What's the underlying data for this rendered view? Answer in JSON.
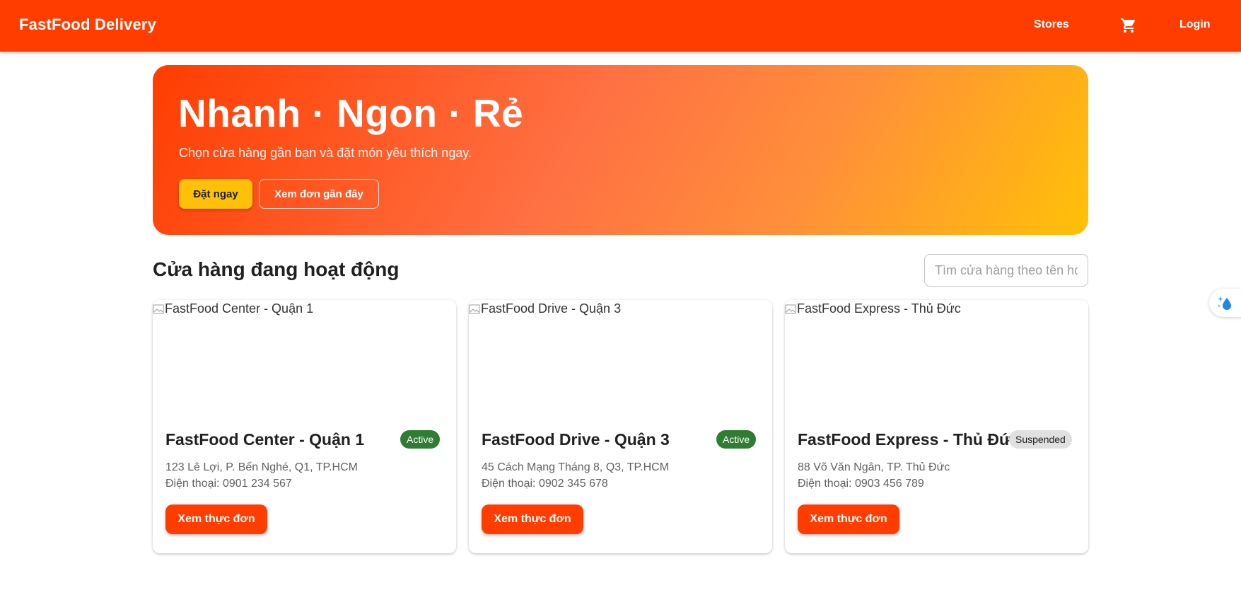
{
  "header": {
    "brand": "FastFood Delivery",
    "nav_stores": "Stores",
    "cart_icon": "shopping-cart-icon",
    "nav_login": "Login",
    "background_color": "#ff3d00"
  },
  "hero": {
    "title": "Nhanh · Ngon · Rẻ",
    "subtitle": "Chọn cửa hàng gần bạn và đặt món yêu thích ngay.",
    "order_button": "Đặt ngay",
    "recent_orders_button": "Xem đơn gần đây"
  },
  "stores_section": {
    "title": "Cửa hàng đang hoạt động",
    "search_placeholder": "Tìm cửa hàng theo tên hoặc địa chỉ"
  },
  "stores": [
    {
      "image_alt": "FastFood Center - Quận 1",
      "name": "FastFood Center - Quận 1",
      "status": "Active",
      "address": "123 Lê Lợi, P. Bến Nghé, Q1, TP.HCM",
      "phone": "Điện thoại: 0901 234 567",
      "menu_button": "Xem thực đơn"
    },
    {
      "image_alt": "FastFood Drive - Quận 3",
      "name": "FastFood Drive - Quận 3",
      "status": "Active",
      "address": "45 Cách Mạng Tháng 8, Q3, TP.HCM",
      "phone": "Điện thoại: 0902 345 678",
      "menu_button": "Xem thực đơn"
    },
    {
      "image_alt": "FastFood Express - Thủ Đức",
      "name": "FastFood Express - Thủ Đức",
      "status": "Suspended",
      "address": "88 Võ Văn Ngân, TP. Thủ Đức",
      "phone": "Điện thoại: 0903 456 789",
      "menu_button": "Xem thực đơn"
    }
  ],
  "colors": {
    "primary": "#ff3d00",
    "accent": "#ffc107",
    "status_active": "#2e7d32",
    "status_suspended": "#e0e0e0"
  },
  "floating_widget_icon": "sparkle-drop-icon"
}
